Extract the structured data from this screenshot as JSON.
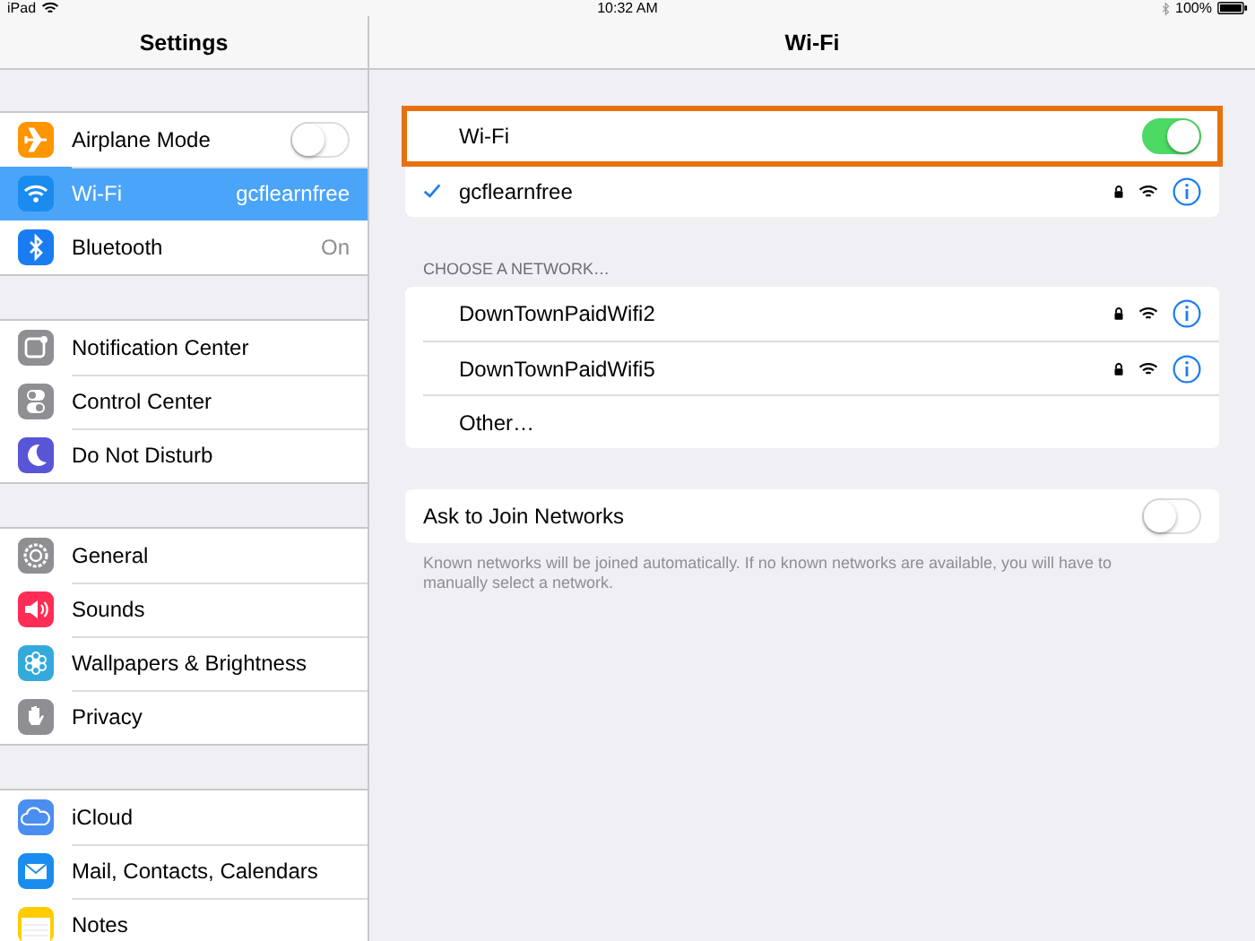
{
  "status_bar": {
    "carrier": "iPad",
    "time": "10:32 AM",
    "battery": "100%"
  },
  "sidebar": {
    "title": "Settings",
    "groups": [
      {
        "items": [
          {
            "label": "Airplane Mode",
            "kind": "toggle",
            "on": false,
            "selected": false,
            "color": "#ff9500"
          },
          {
            "label": "Wi-Fi",
            "kind": "value",
            "value": "gcflearnfree",
            "selected": true,
            "color": "#1a8cf0"
          },
          {
            "label": "Bluetooth",
            "kind": "value",
            "value": "On",
            "selected": false,
            "color": "#1a7cf0"
          }
        ]
      },
      {
        "items": [
          {
            "label": "Notification Center",
            "kind": "plain",
            "selected": false,
            "color": "#8e8e93"
          },
          {
            "label": "Control Center",
            "kind": "plain",
            "selected": false,
            "color": "#8e8e93"
          },
          {
            "label": "Do Not Disturb",
            "kind": "plain",
            "selected": false,
            "color": "#5856d6"
          }
        ]
      },
      {
        "items": [
          {
            "label": "General",
            "kind": "plain",
            "selected": false,
            "color": "#8e8e93"
          },
          {
            "label": "Sounds",
            "kind": "plain",
            "selected": false,
            "color": "#ff2d55"
          },
          {
            "label": "Wallpapers & Brightness",
            "kind": "plain",
            "selected": false,
            "color": "#34aadc"
          },
          {
            "label": "Privacy",
            "kind": "plain",
            "selected": false,
            "color": "#8e8e93"
          }
        ]
      },
      {
        "items": [
          {
            "label": "iCloud",
            "kind": "plain",
            "selected": false,
            "color": "#4a8ef0"
          },
          {
            "label": "Mail, Contacts, Calendars",
            "kind": "plain",
            "selected": false,
            "color": "#1a8cf0"
          },
          {
            "label": "Notes",
            "kind": "plain",
            "selected": false,
            "color": "#ffcc00"
          }
        ]
      }
    ]
  },
  "detail": {
    "title": "Wi-Fi",
    "wifi": {
      "label": "Wi-Fi",
      "on": true,
      "highlighted": true
    },
    "current": {
      "name": "gcflearnfree",
      "connected": true,
      "secured": true
    },
    "section_header": "CHOOSE A NETWORK…",
    "networks": [
      {
        "name": "DownTownPaidWifi2",
        "secured": true
      },
      {
        "name": "DownTownPaidWifi5",
        "secured": true
      },
      {
        "name": "Other…",
        "kind": "other"
      }
    ],
    "ask_to_join": {
      "label": "Ask to Join Networks",
      "on": false
    },
    "footer": "Known networks will be joined automatically. If no known networks are available, you will have to manually select a network."
  }
}
